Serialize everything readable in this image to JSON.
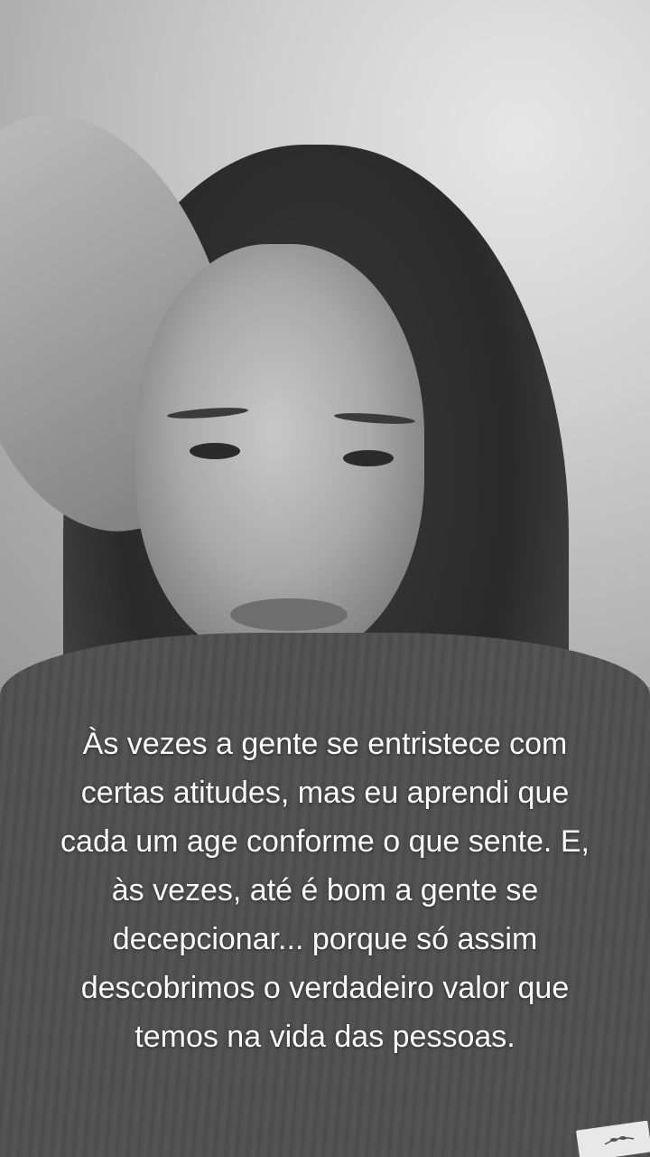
{
  "caption": {
    "lines": [
      "Às vezes a gente se entristece com",
      "certas atitudes, mas eu aprendi que",
      "cada um age conforme o que sente. E,",
      "às vezes, até é bom a gente se",
      "decepcionar... porque só assim",
      "descobrimos o verdadeiro valor que",
      "temos na vida das pessoas."
    ]
  },
  "photo": {
    "style": "black-and-white selfie"
  },
  "sticker": {
    "icon": "leaf-sprig-icon"
  },
  "colors": {
    "text": "#ffffff",
    "background": "#6b6b6b"
  }
}
